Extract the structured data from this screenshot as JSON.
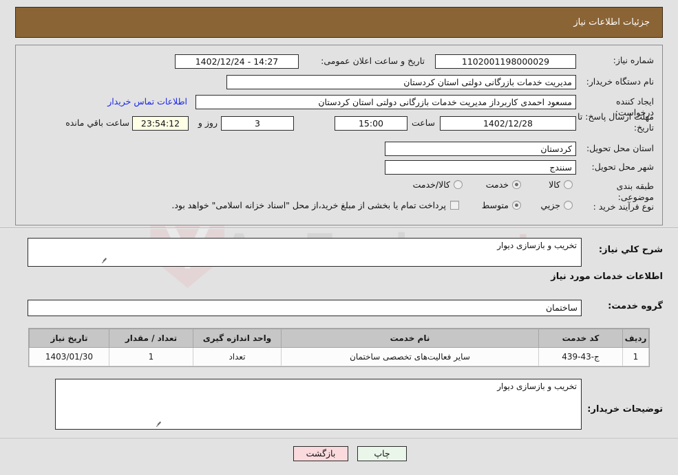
{
  "header": {
    "title": "جزئیات اطلاعات نیاز"
  },
  "info": {
    "need_number_label": "شماره نیاز:",
    "need_number_value": "1102001198000029",
    "announce_datetime_label": "تاریخ و ساعت اعلان عمومی:",
    "announce_datetime_value": "14:27 - 1402/12/24",
    "buyer_org_label": "نام دستگاه خریدار:",
    "buyer_org_value": "مدیریت خدمات بازرگانی دولتی استان کردستان",
    "creator_label": "ایجاد کننده درخواست:",
    "creator_value": "مسعود احمدی کاربرداز مدیریت خدمات بازرگانی دولتی استان کردستان",
    "buyer_contact_link": "اطلاعات تماس خریدار",
    "deadline_label": "مهلت ارسال پاسخ: تا تاریخ:",
    "deadline_date": "1402/12/28",
    "hour_label": "ساعت",
    "deadline_time": "15:00",
    "days_value": "3",
    "days_suffix": "روز و",
    "countdown_value": "23:54:12",
    "countdown_suffix": "ساعت باقي مانده",
    "province_label": "استان محل تحویل:",
    "province_value": "کردستان",
    "city_label": "شهر محل تحویل:",
    "city_value": "سنندج",
    "category_label": "طبقه بندی موضوعی:",
    "category_options": [
      "کالا",
      "خدمت",
      "کالا/خدمت"
    ],
    "category_selected_index": 1,
    "purchase_type_label": "نوع فرآیند خرید :",
    "purchase_options": [
      "جزیي",
      "متوسط"
    ],
    "purchase_selected_index": 1,
    "treasury_checkbox_label": "پرداخت تمام یا بخشی از مبلغ خرید،از محل \"اسناد خزانه اسلامی\" خواهد بود.",
    "treasury_checked": false
  },
  "summary": {
    "label": "شرح کلي نیاز:",
    "value": "تخریب و بازسازی دیوار"
  },
  "services": {
    "section_title": "اطلاعات خدمات مورد نیاز",
    "group_label": "گروه خدمت:",
    "group_value": "ساختمان",
    "columns": [
      "ردیف",
      "کد خدمت",
      "نام خدمت",
      "واحد اندازه گیری",
      "تعداد / مقدار",
      "تاریخ نیاز"
    ],
    "rows": [
      {
        "row_no": "1",
        "service_code": "ج-43-439",
        "service_name": "سایر فعالیت‌های تخصصی ساختمان",
        "unit": "تعداد",
        "quantity": "1",
        "need_date": "1403/01/30"
      }
    ]
  },
  "buyer_notes": {
    "label": "توضیحات خریدار:",
    "value": "تخریب و بازسازی دیوار"
  },
  "footer": {
    "print_label": "چاپ",
    "back_label": "بازگشت"
  },
  "watermark": {
    "text_left": "AnaTender",
    "text_right": ".net"
  },
  "colors": {
    "header_brown": "#8b6436",
    "page_bg": "#e2e2e2",
    "link_blue": "#1b27e8",
    "countdown_bg": "#ffffe6",
    "table_header_bg": "#c6c6c6",
    "btn_print_bg": "#eaf6ea",
    "btn_back_bg": "#fadadd"
  }
}
